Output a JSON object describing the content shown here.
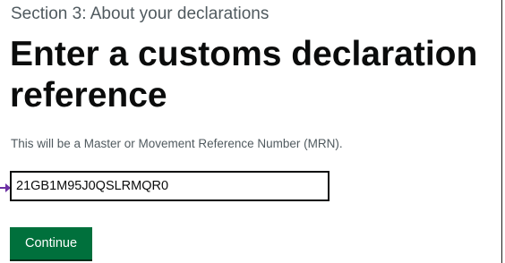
{
  "section": {
    "caption": "Section 3: About your declarations"
  },
  "page": {
    "heading_line1": "Enter a customs declaration",
    "heading_line2": "reference"
  },
  "form": {
    "hint": "This will be a Master or Movement Reference Number (MRN).",
    "mrn_value": "21GB1M95J0QSLRMQR0",
    "continue_label": "Continue"
  },
  "colors": {
    "button_green": "#00703c",
    "text_black": "#0b0c0c",
    "secondary_grey": "#505a5f",
    "pointer_purple": "#6b2fa3"
  }
}
